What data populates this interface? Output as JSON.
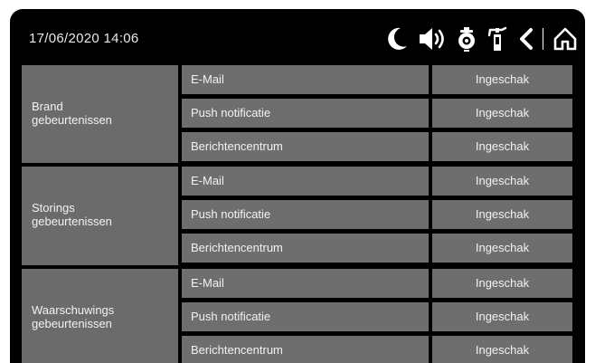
{
  "header": {
    "datetime": "17/06/2020  14:06",
    "icons": [
      "moon-icon",
      "speaker-icon",
      "detector-icon",
      "extinguisher-icon",
      "back-chevron-icon",
      "home-icon"
    ]
  },
  "colors": {
    "background": "#000000",
    "cell": "#6e6e6e",
    "text": "#f2f2f2"
  },
  "groups": [
    {
      "label_line1": "Brand",
      "label_line2": "gebeurtenissen",
      "channels": [
        {
          "name": "E-Mail",
          "status": "Ingeschak"
        },
        {
          "name": "Push notificatie",
          "status": "Ingeschak"
        },
        {
          "name": "Berichtencentrum",
          "status": "Ingeschak"
        }
      ]
    },
    {
      "label_line1": "Storings",
      "label_line2": "gebeurtenissen",
      "channels": [
        {
          "name": "E-Mail",
          "status": "Ingeschak"
        },
        {
          "name": "Push notificatie",
          "status": "Ingeschak"
        },
        {
          "name": "Berichtencentrum",
          "status": "Ingeschak"
        }
      ]
    },
    {
      "label_line1": "Waarschuwings",
      "label_line2": "gebeurtenissen",
      "channels": [
        {
          "name": "E-Mail",
          "status": "Ingeschak"
        },
        {
          "name": "Push notificatie",
          "status": "Ingeschak"
        },
        {
          "name": "Berichtencentrum",
          "status": "Ingeschak"
        }
      ]
    }
  ]
}
